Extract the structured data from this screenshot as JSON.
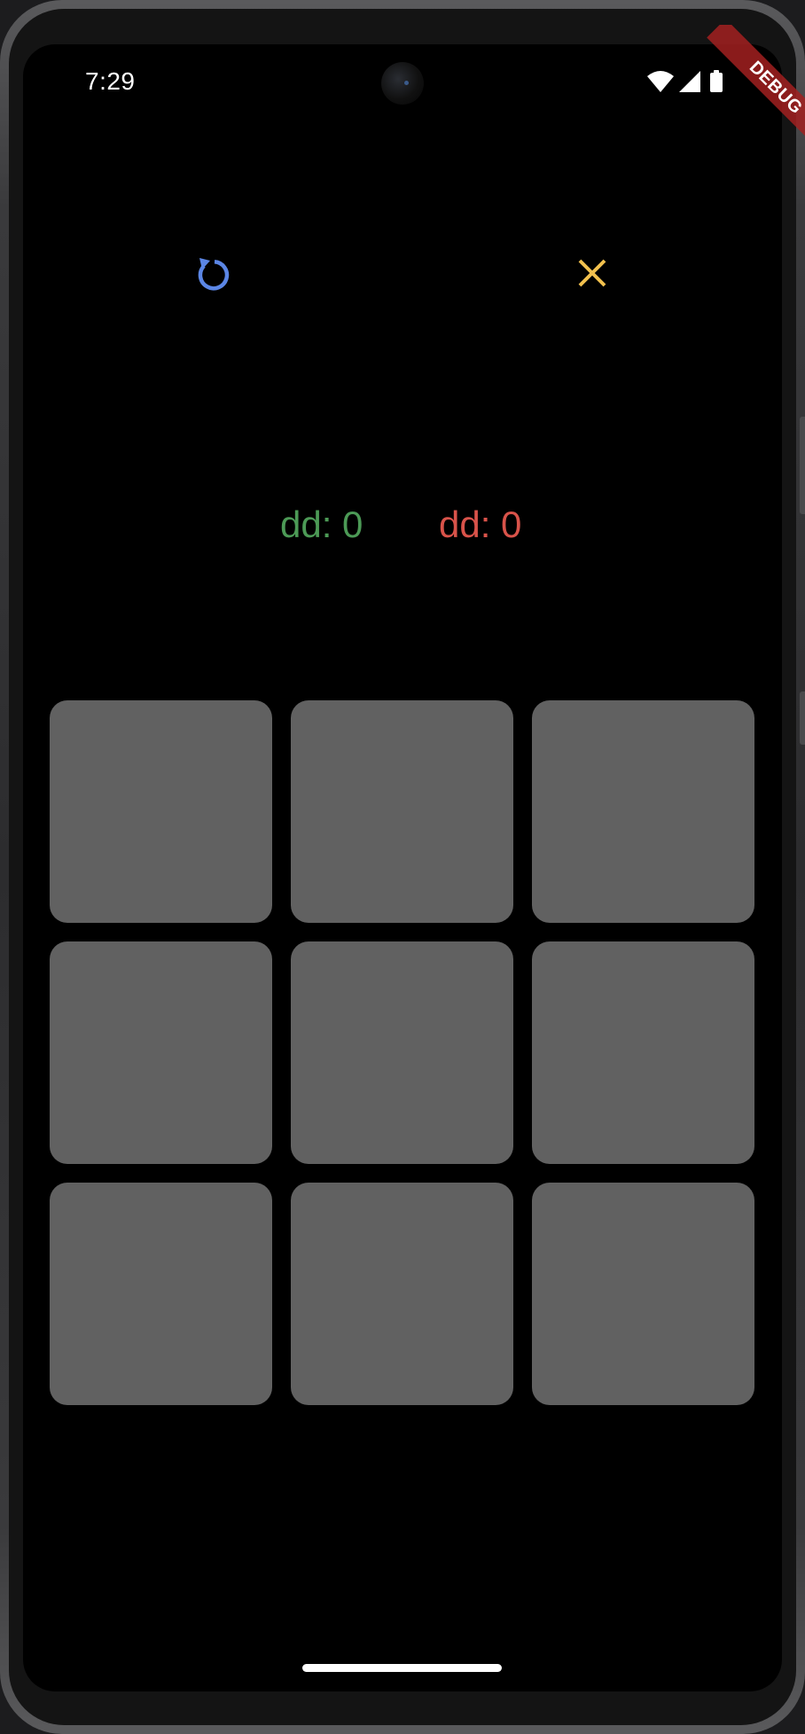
{
  "status_bar": {
    "time": "7:29"
  },
  "debug_banner": {
    "label": "DEBUG"
  },
  "toolbar": {
    "refresh_icon": "refresh-icon",
    "close_icon": "close-icon"
  },
  "scores": [
    {
      "text": "dd: 0",
      "color": "#4c9a56"
    },
    {
      "text": "dd: 0",
      "color": "#d9534a"
    }
  ],
  "board": {
    "rows": 3,
    "cols": 3,
    "cells": [
      "",
      "",
      "",
      "",
      "",
      "",
      "",
      "",
      ""
    ]
  },
  "colors": {
    "background": "#000000",
    "cell": "#616161",
    "refresh_icon": "#5b86e5",
    "close_icon": "#f2c14e",
    "player_one": "#4c9a56",
    "player_two": "#d9534a"
  }
}
